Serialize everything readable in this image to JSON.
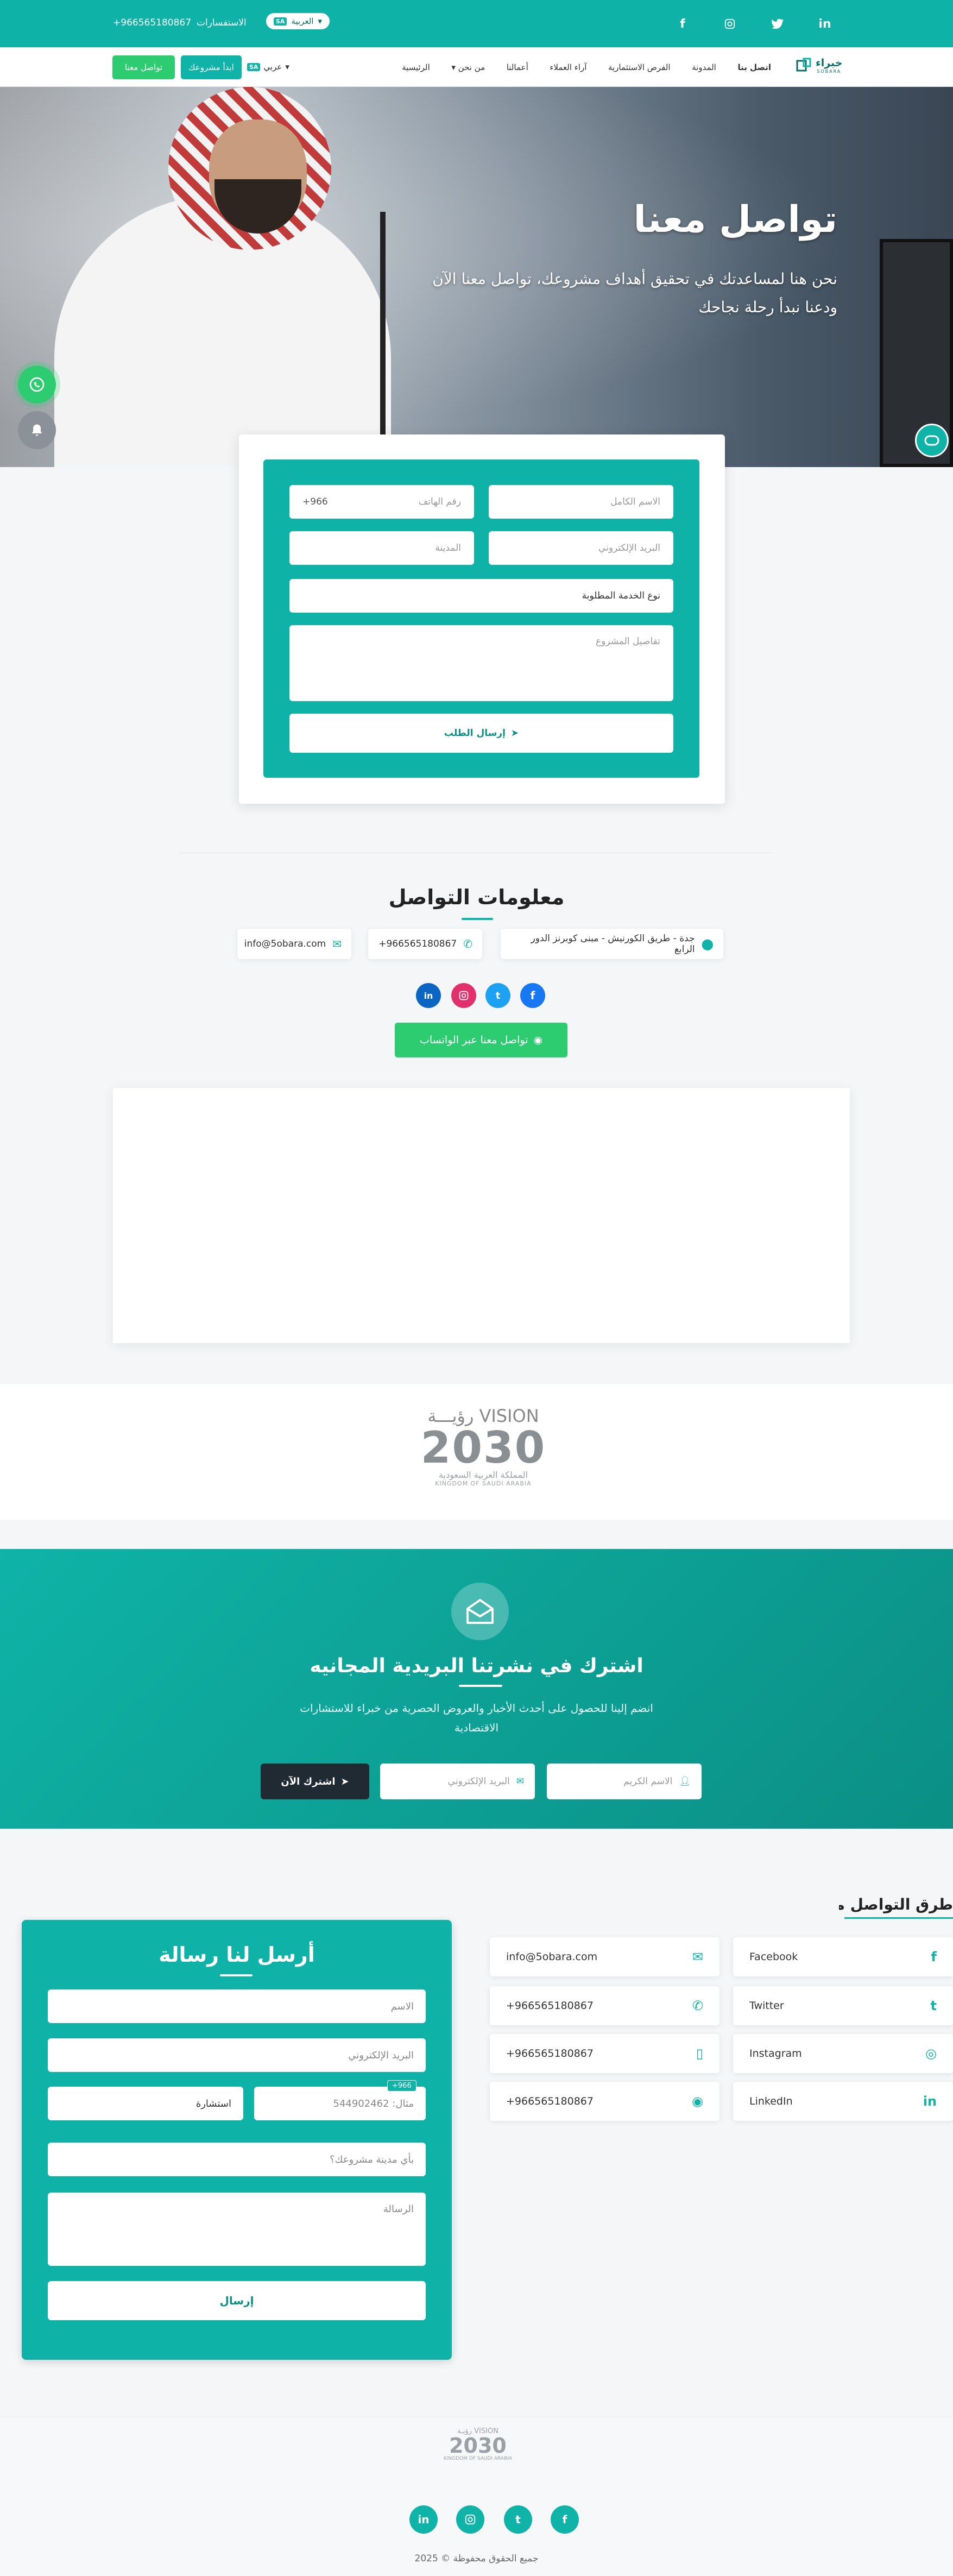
{
  "topbar": {
    "phone": "966565180867+",
    "inquiries_label": "الاستفسارات",
    "lang_label": "العربية",
    "lang_flag": "SA",
    "social": [
      "in",
      "t",
      "ig",
      "f"
    ]
  },
  "nav": {
    "brand": "خبراء",
    "brand_sub": "SOBARA",
    "items": [
      "الرئيسية",
      "من نحن",
      "أعمالنا",
      "آراء العملاء",
      "الفرص الاستثمارية",
      "المدونة",
      "اتصل بنا"
    ],
    "lang": "عربي",
    "start_project": "ابدأ مشروعك",
    "contact_btn": "تواصل معنا"
  },
  "hero": {
    "title": "تواصل معنا",
    "subtitle_line1": "نحن هنا لمساعدتك في تحقيق أهداف مشروعك، تواصل معنا الآن",
    "subtitle_line2": "ودعنا نبدأ رحلة نجاحك"
  },
  "contact_form": {
    "full_name": "الاسم الكامل",
    "phone": "رقم الهاتف",
    "phone_code": "966+",
    "email": "البريد الإلكتروني",
    "city": "المدينة",
    "service_type": "نوع الخدمة المطلوبة",
    "project_details": "تفاصيل المشروع",
    "submit": "إرسال الطلب"
  },
  "contact_info": {
    "title": "معلومات التواصل",
    "address": "جدة - طريق الكورنيش - مبنى كوبرنز الدور الرابع",
    "phone": "966565180867+",
    "email": "info@5obara.com",
    "whatsapp_btn": "تواصل معنا عبر الواتساب"
  },
  "vision": {
    "title_ar": "رؤيـــة",
    "title_en": "VISION",
    "year": "2030",
    "kingdom_ar": "المملكة العربية السعودية",
    "kingdom_en": "KINGDOM OF SAUDI ARABIA"
  },
  "newsletter": {
    "title": "اشترك في نشرتنا البريدية المجانيه",
    "desc_line1": "انضم إلينا للحصول على أحدث الأخبار والعروض الحصرية من خبراء للاستشارات",
    "desc_line2": "الاقتصادية",
    "name_placeholder": "الاسم الكريم",
    "email_placeholder": "البريد الإلكتروني",
    "subscribe": "اشترك الآن"
  },
  "channels": {
    "title": "طرق التواصل معنا",
    "rows": [
      {
        "left": "info@5obara.com",
        "right": "Facebook"
      },
      {
        "left": "966565180867+",
        "right": "Twitter"
      },
      {
        "left": "966565180867+",
        "right": "Instagram"
      },
      {
        "left": "966565180867+",
        "right": "LinkedIn"
      }
    ]
  },
  "message_form": {
    "title": "أرسل لنا رسالة",
    "name": "الاسم",
    "email": "البريد الإلكتروني",
    "phone_ex": "مثال: 544902462",
    "phone_code": "966+",
    "consult": "استشارة",
    "city_q": "بأي مدينة مشروعك؟",
    "message": "الرسالة",
    "send": "إرسال"
  },
  "footer": {
    "copyright": "جميع الحقوق محفوظة © 2025"
  },
  "colors": {
    "primary": "#0fb3a7",
    "whatsapp": "#2ecc71",
    "dark": "#1f2a33"
  }
}
